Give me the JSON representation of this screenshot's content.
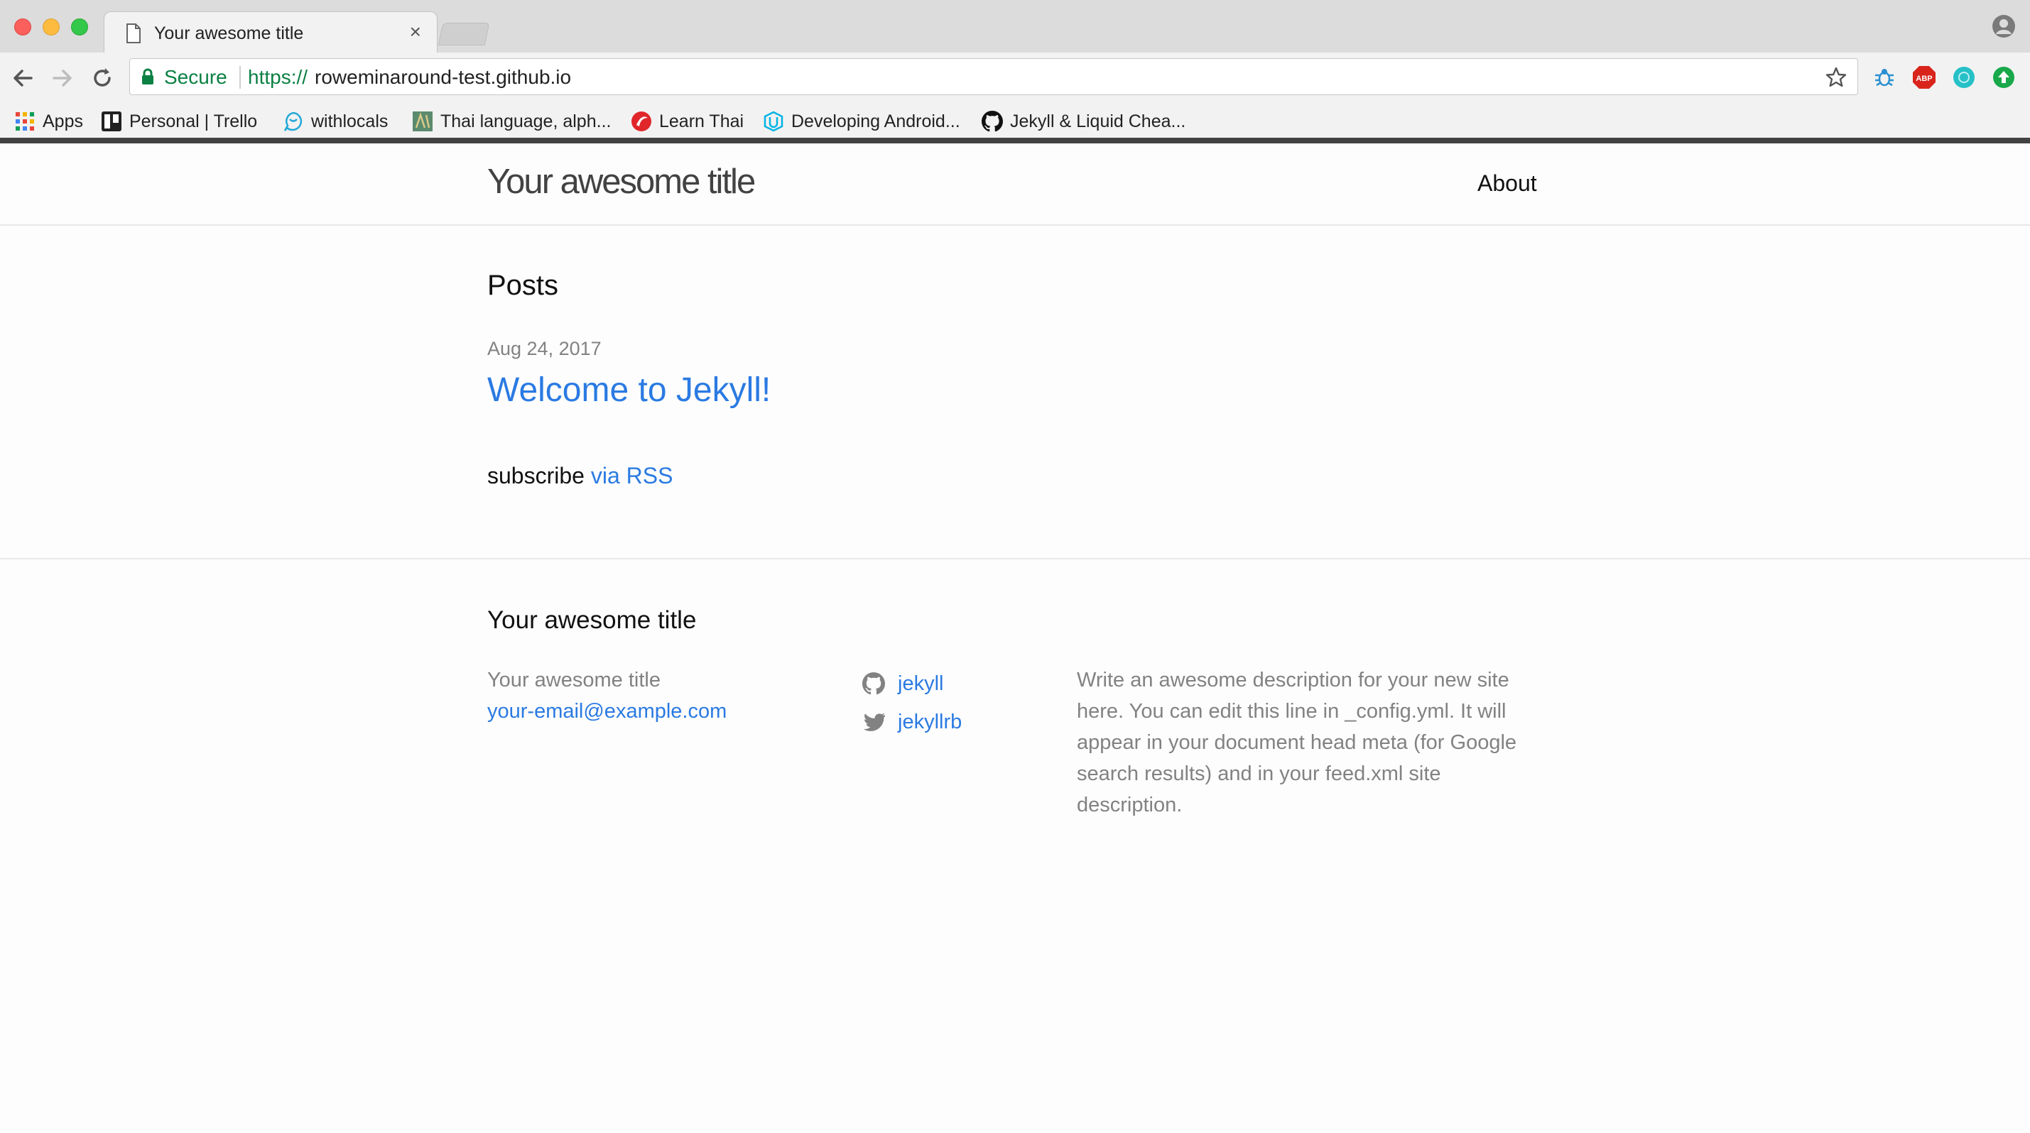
{
  "browser": {
    "tab_title": "Your awesome title",
    "tab_close": "×",
    "secure_label": "Secure",
    "url_scheme": "https://",
    "url_host": "roweminaround-test.github.io",
    "bookmarks": [
      {
        "label": "Apps",
        "icon": "apps-grid-icon"
      },
      {
        "label": "Personal | Trello",
        "icon": "trello-icon"
      },
      {
        "label": "withlocals",
        "icon": "withlocals-icon"
      },
      {
        "label": "Thai language, alph...",
        "icon": "thai-language-icon"
      },
      {
        "label": "Learn Thai",
        "icon": "learn-thai-icon"
      },
      {
        "label": "Developing Android...",
        "icon": "udacity-icon"
      },
      {
        "label": "Jekyll & Liquid Chea...",
        "icon": "github-icon"
      }
    ],
    "extensions": [
      "bug-extension-icon",
      "adblock-plus-icon",
      "teal-circle-extension-icon",
      "green-upload-extension-icon"
    ],
    "colors": {
      "secure_green": "#0b8043",
      "chrome_bg": "#f2f2f2"
    }
  },
  "site": {
    "title": "Your awesome title",
    "nav": {
      "about": "About"
    },
    "posts_heading": "Posts",
    "posts": [
      {
        "date": "Aug 24, 2017",
        "title": "Welcome to Jekyll!"
      }
    ],
    "subscribe": {
      "prefix": "subscribe",
      "link": "via RSS"
    },
    "footer": {
      "heading": "Your awesome title",
      "name": "Your awesome title",
      "email": "your-email@example.com",
      "github_username": "jekyll",
      "twitter_username": "jekyllrb",
      "description": "Write an awesome description for your new site here. You can edit this line in _config.yml. It will appear in your document head meta (for Google search results) and in your feed.xml site description."
    },
    "colors": {
      "link": "#2a7ae2",
      "muted": "#828282",
      "text": "#111111"
    }
  }
}
